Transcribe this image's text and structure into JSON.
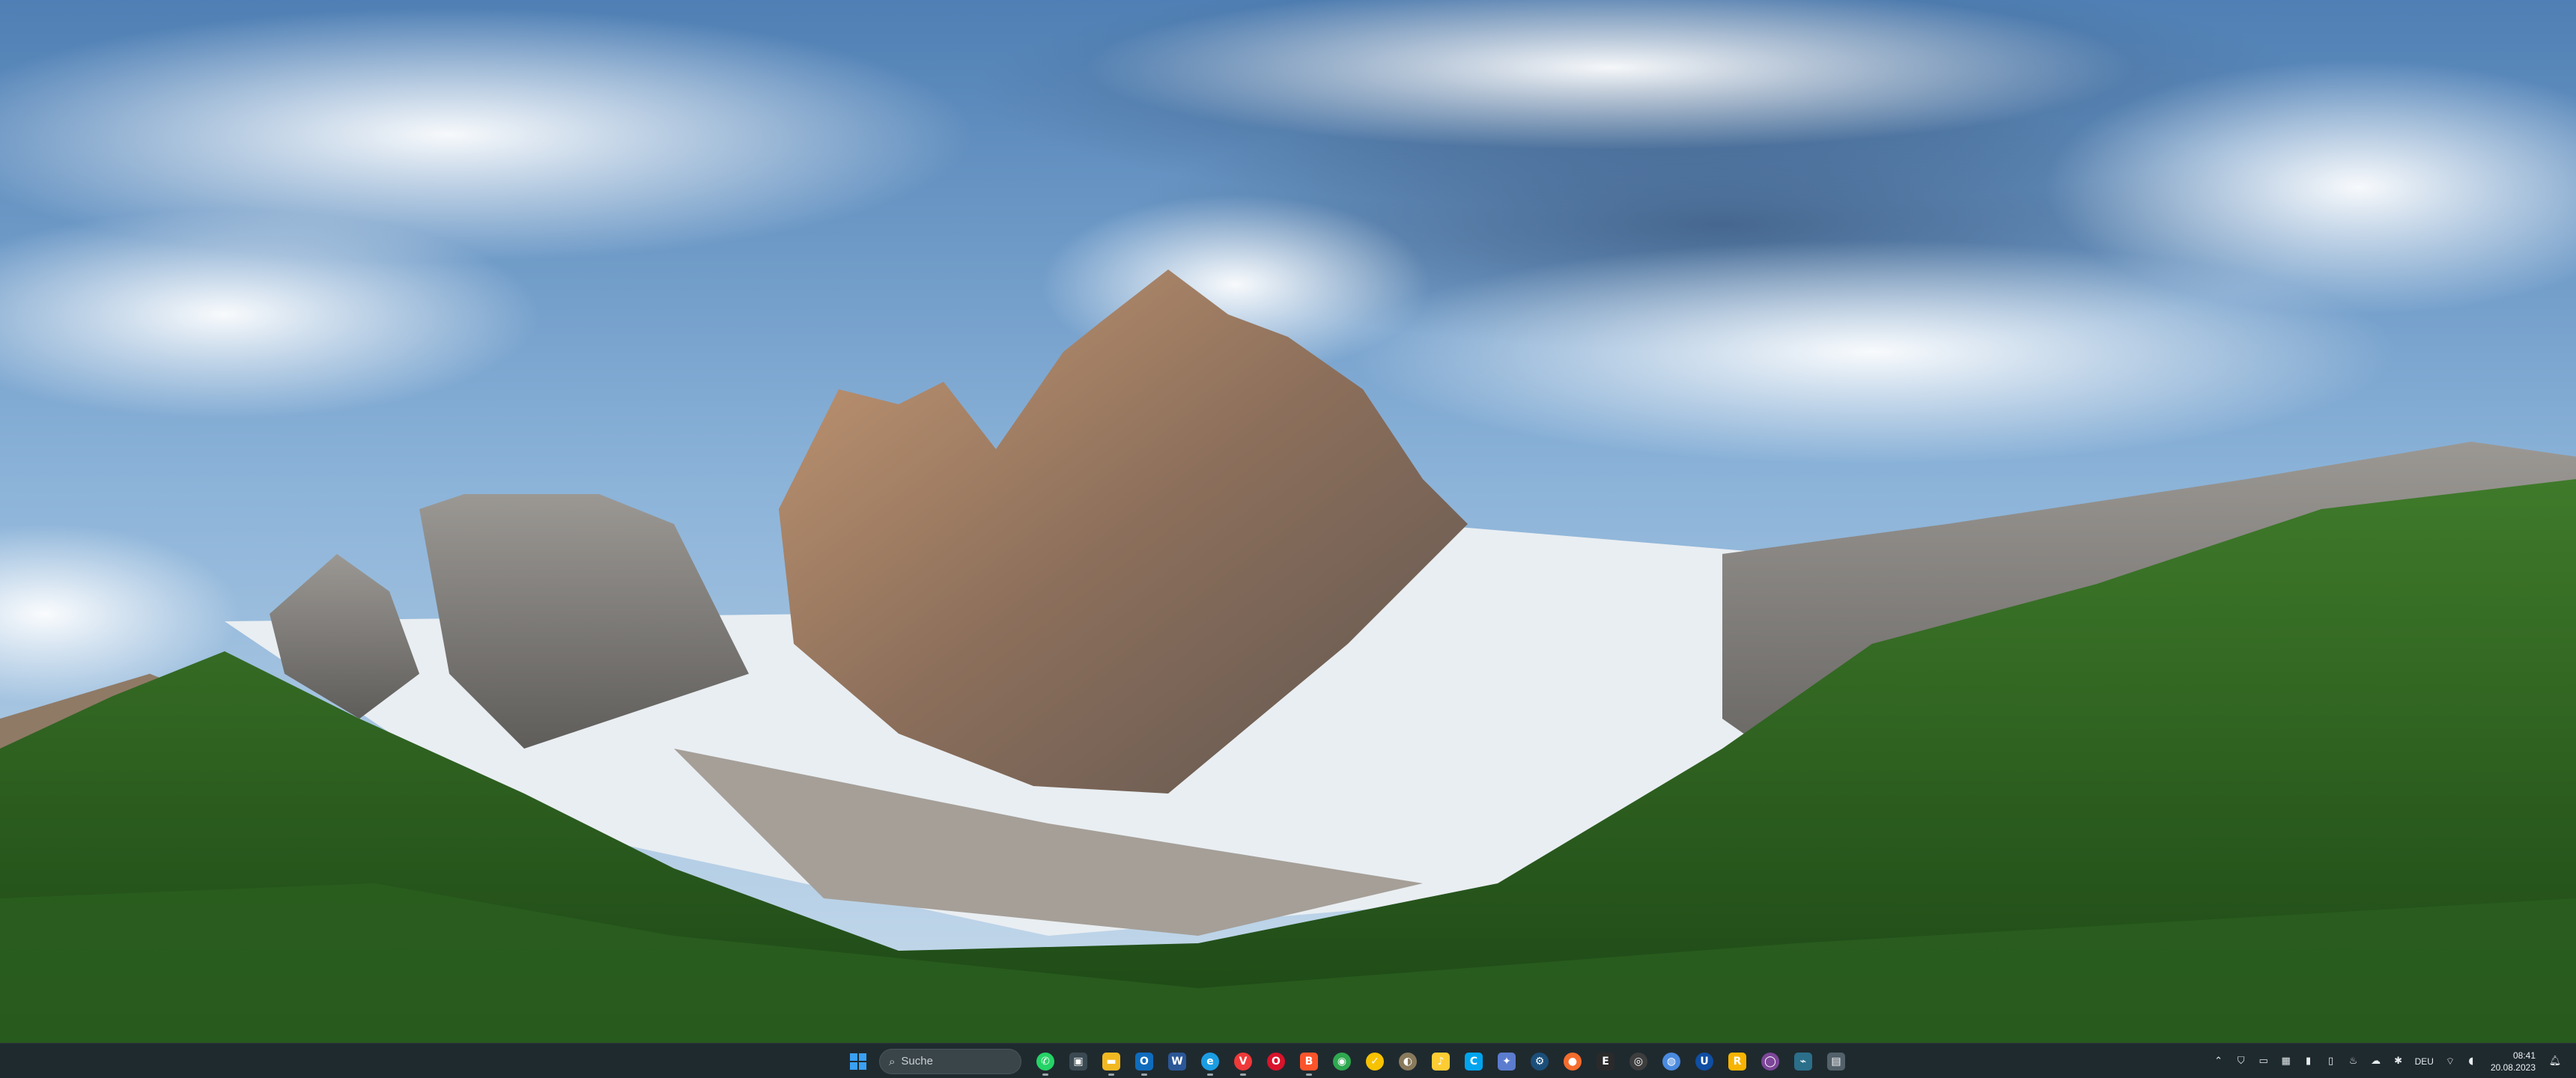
{
  "taskbar": {
    "search": {
      "icon": "search-icon",
      "label": "Suche"
    },
    "start": {
      "icon": "windows-logo-icon"
    },
    "pinned": [
      {
        "name": "whatsapp-icon",
        "glyph": "✆",
        "bg": "#25d366",
        "round": true,
        "running": true
      },
      {
        "name": "task-view-icon",
        "glyph": "▣",
        "bg": "#3b4a52",
        "round": false,
        "running": false
      },
      {
        "name": "file-explorer-icon",
        "glyph": "▬",
        "bg": "#f2b821",
        "round": false,
        "running": true
      },
      {
        "name": "outlook-icon",
        "glyph": "O",
        "bg": "#0f6cbd",
        "round": false,
        "running": true
      },
      {
        "name": "word-icon",
        "glyph": "W",
        "bg": "#2b5797",
        "round": false,
        "running": false
      },
      {
        "name": "edge-icon",
        "glyph": "e",
        "bg": "#1b9de2",
        "round": true,
        "running": true
      },
      {
        "name": "vivaldi-icon",
        "glyph": "V",
        "bg": "#ef3939",
        "round": true,
        "running": true
      },
      {
        "name": "opera-icon",
        "glyph": "O",
        "bg": "#d9132b",
        "round": true,
        "running": false
      },
      {
        "name": "brave-icon",
        "glyph": "B",
        "bg": "#fb542b",
        "round": false,
        "running": true
      },
      {
        "name": "chrome-icon",
        "glyph": "◉",
        "bg": "#2fa84f",
        "round": true,
        "running": false
      },
      {
        "name": "norton-icon",
        "glyph": "✓",
        "bg": "#f7c200",
        "round": true,
        "running": false
      },
      {
        "name": "gimp-icon",
        "glyph": "◐",
        "bg": "#8a7a5c",
        "round": true,
        "running": false
      },
      {
        "name": "settings-app-icon",
        "glyph": "♪",
        "bg": "#ffcc33",
        "round": false,
        "running": false
      },
      {
        "name": "cortana-icon",
        "glyph": "C",
        "bg": "#00a4ef",
        "round": false,
        "running": false
      },
      {
        "name": "copilot-icon",
        "glyph": "✦",
        "bg": "#5b7ccf",
        "round": false,
        "running": false
      },
      {
        "name": "steam-icon",
        "glyph": "⚙",
        "bg": "#1b4f7a",
        "round": true,
        "running": false
      },
      {
        "name": "origin-icon",
        "glyph": "●",
        "bg": "#f56c2d",
        "round": true,
        "running": false
      },
      {
        "name": "epic-games-icon",
        "glyph": "E",
        "bg": "#2a2a2a",
        "round": false,
        "running": false
      },
      {
        "name": "obs-icon",
        "glyph": "◎",
        "bg": "#3d3d3d",
        "round": true,
        "running": false
      },
      {
        "name": "chromium-icon",
        "glyph": "◍",
        "bg": "#4a8ae0",
        "round": true,
        "running": false
      },
      {
        "name": "ubisoft-icon",
        "glyph": "U",
        "bg": "#0f4ea3",
        "round": true,
        "running": false
      },
      {
        "name": "rockstar-icon",
        "glyph": "R",
        "bg": "#f8b400",
        "round": false,
        "running": false
      },
      {
        "name": "tor-browser-icon",
        "glyph": "◯",
        "bg": "#7d4698",
        "round": true,
        "running": false
      },
      {
        "name": "network-app-icon",
        "glyph": "⌁",
        "bg": "#2b6f8a",
        "round": false,
        "running": false
      },
      {
        "name": "virtual-machine-icon",
        "glyph": "▤",
        "bg": "#53616a",
        "round": false,
        "running": false
      }
    ]
  },
  "tray": {
    "icons": [
      {
        "name": "chevron-up-icon",
        "glyph": "⌃"
      },
      {
        "name": "shield-icon",
        "glyph": "⛉"
      },
      {
        "name": "screen-icon",
        "glyph": "▭"
      },
      {
        "name": "teams-icon",
        "glyph": "▦"
      },
      {
        "name": "usb-icon",
        "glyph": "▮"
      },
      {
        "name": "phone-link-icon",
        "glyph": "▯"
      },
      {
        "name": "steam-tray-icon",
        "glyph": "♨"
      },
      {
        "name": "onedrive-icon",
        "glyph": "☁"
      },
      {
        "name": "bluetooth-icon",
        "glyph": "✱"
      }
    ],
    "language": "DEU",
    "status_icons": [
      {
        "name": "wifi-icon",
        "glyph": "⌔"
      },
      {
        "name": "speaker-icon",
        "glyph": "◖"
      }
    ],
    "time": "08:41",
    "date": "20.08.2023",
    "notification_icon": "notification-bell-icon"
  }
}
